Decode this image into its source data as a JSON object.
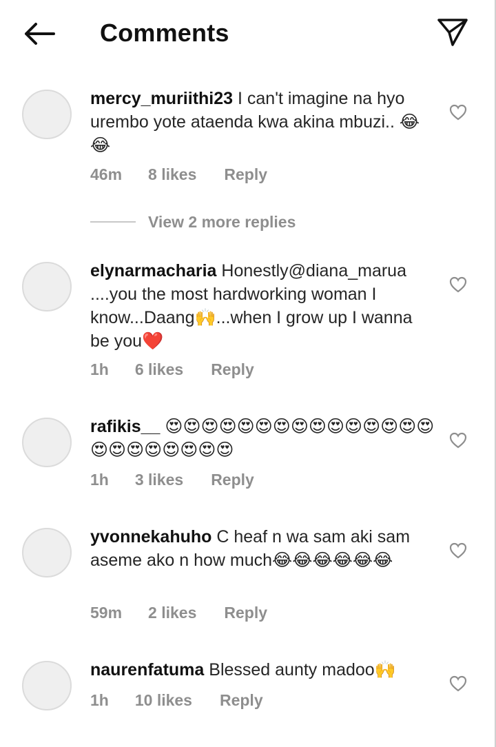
{
  "header": {
    "title": "Comments"
  },
  "comments": [
    {
      "username": "mercy_muriithi23",
      "text": "I can't imagine na hyo urembo yote ataenda kwa akina mbuzi..",
      "emoji": "😂😂",
      "time": "46m",
      "likes": "8 likes",
      "reply": "Reply"
    },
    {
      "username": "elynarmacharia",
      "text": "Honestly@diana_marua ....you the most hardworking woman I know...Daang🙌...when I grow up I wanna be you",
      "emoji": "❤️",
      "time": "1h",
      "likes": "6 likes",
      "reply": "Reply"
    },
    {
      "username": "rafikis__",
      "text": "",
      "emoji": "😍😍😍😍😍😍😍😍😍😍😍😍😍😍😍😍😍😍😍😍😍😍😍",
      "time": "1h",
      "likes": "3 likes",
      "reply": "Reply"
    },
    {
      "username": "yvonnekahuho",
      "text": "C heaf n wa sam aki sam aseme ako n how much",
      "emoji": "😂😂😂😂😂😂",
      "time": "59m",
      "likes": "2 likes",
      "reply": "Reply"
    },
    {
      "username": "naurenfatuma",
      "text": "Blessed aunty madoo",
      "emoji": "🙌",
      "time": "1h",
      "likes": "10 likes",
      "reply": "Reply"
    }
  ],
  "view_replies": "View 2 more replies",
  "colors": {
    "text": "#262626",
    "meta": "#8e8e8e",
    "avatar_bg": "#efefef"
  }
}
